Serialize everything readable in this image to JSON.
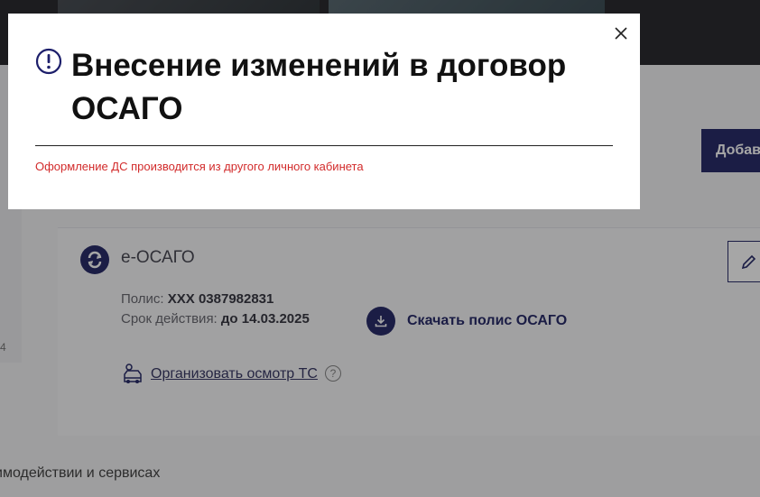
{
  "background": {
    "add_button_label": "Добавить",
    "product_name": "е-ОСАГО",
    "policy": {
      "label": "Полис:",
      "value": "XXX 0387982831"
    },
    "term": {
      "label": "Срок действия:",
      "value": "до 14.03.2025"
    },
    "download_label": "Скачать полис ОСАГО",
    "inspection_link": "Организовать осмотр ТС",
    "help_glyph": "?",
    "footer_text": "имодействии и сервисах",
    "side_mark": "4"
  },
  "modal": {
    "title": "Внесение изменений в договор ОСАГО",
    "message": "Оформление ДС производится из другого личного кабинета",
    "close_icon": "close-icon",
    "alert_icon": "exclamation-circle-icon",
    "colors": {
      "accent": "#2a2d6b",
      "error": "#d22b2b"
    }
  }
}
